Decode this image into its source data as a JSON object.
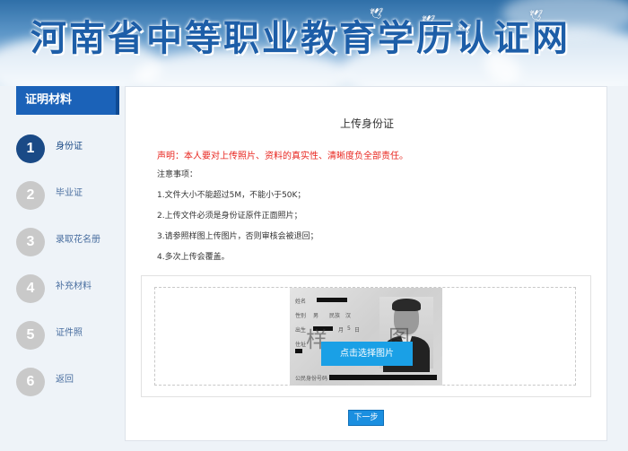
{
  "banner": {
    "title": "河南省中等职业教育学历认证网"
  },
  "nav": {
    "header": "证明材料",
    "steps": [
      {
        "number": "1",
        "label": "身份证",
        "active": true
      },
      {
        "number": "2",
        "label": "毕业证",
        "active": false
      },
      {
        "number": "3",
        "label": "录取花名册",
        "active": false
      },
      {
        "number": "4",
        "label": "补充材料",
        "active": false
      },
      {
        "number": "5",
        "label": "证件照",
        "active": false
      },
      {
        "number": "6",
        "label": "返回",
        "active": false
      }
    ]
  },
  "main": {
    "title": "上传身份证",
    "declaration": "声明：本人要对上传照片、资料的真实性、清晰度负全部责任。",
    "notes_title": "注意事项：",
    "notes": [
      "1.文件大小不能超过5M，不能小于50K；",
      "2.上传文件必须是身份证原件正面照片；",
      "3.请参照样图上传图片，否则审核会被退回；",
      "4.多次上传会覆盖。"
    ],
    "sample": {
      "field_name": "姓名",
      "field_gender": "性别",
      "gender_value": "男",
      "field_ethnicity": "民族",
      "ethnicity_value": "汉",
      "field_birth": "出生",
      "birth_day_label": "月",
      "birth_day_value": "5",
      "birth_day_unit": "日",
      "field_address": "住址",
      "field_id": "公民身份号码",
      "watermark_left": "样",
      "watermark_right": "图"
    },
    "choose_button": "点击选择图片",
    "next_button": "下一步"
  },
  "colors": {
    "nav_header_bg": "#1b62b8",
    "active_step": "#1a4a86",
    "inactive_step": "#c9c9c9",
    "declaration": "#e8261f",
    "choose_button_bg": "#1aa0e6",
    "next_button_bg": "#1b8fe0"
  }
}
